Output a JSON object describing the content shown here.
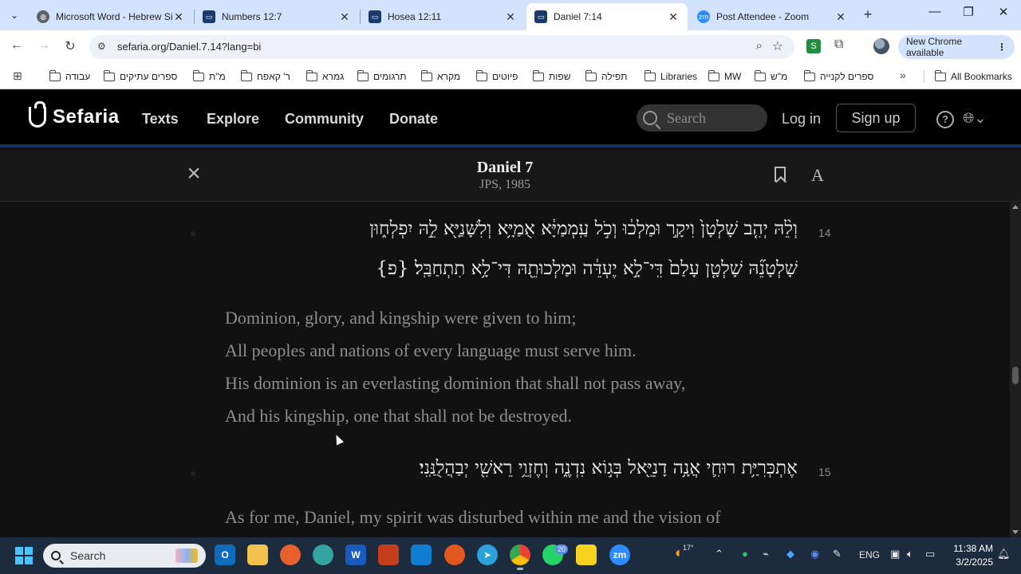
{
  "browser": {
    "tabs": [
      {
        "title": "Microsoft Word - Hebrew Si",
        "icon": "globe-icon",
        "active": false
      },
      {
        "title": "Numbers 12:7",
        "icon": "sefaria-icon",
        "active": false
      },
      {
        "title": "Hosea 12:11",
        "icon": "sefaria-icon",
        "active": false
      },
      {
        "title": "Daniel 7:14",
        "icon": "sefaria-icon",
        "active": true
      },
      {
        "title": "Post Attendee - Zoom",
        "icon": "zoom-icon",
        "active": false
      }
    ],
    "url": "sefaria.org/Daniel.7.14?lang=bi",
    "update_label": "New Chrome available",
    "bookmarks": [
      "עבודה",
      "ספרים עתיקים",
      "מ\"ת",
      "ר' קאפח",
      "גמרא",
      "תרגומים",
      "מקרא",
      "פיוטים",
      "שפות",
      "תפילה",
      "Libraries",
      "MW",
      "מ\"ש",
      "ספרים לקנייה"
    ],
    "all_bookmarks": "All Bookmarks"
  },
  "site": {
    "brand": "Sefaria",
    "nav": [
      "Texts",
      "Explore",
      "Community",
      "Donate"
    ],
    "search_placeholder": "Search",
    "login": "Log in",
    "signup": "Sign up"
  },
  "reader": {
    "title": "Daniel 7",
    "version": "JPS, 1985",
    "font_toggle": "A",
    "verses": [
      {
        "num": "14",
        "hebrew": [
          "וְלֵ֨הּ יְהִ֤ב שָׁלְטָן֙ וִיקָ֣ר וּמַלְכ֔וּ וְכֹ֣ל עַֽמְמַיָּ֔א אֻמַיָּ֥א וְלִשָּׁנַיָּ֖א לֵ֣הּ יִפְלְח֑וּן",
          "שָׁלְטָנֵ֞הּ שָׁלְטָ֤ן עָלַם֙ דִּֽי־לָ֣א יֶעְדֵּ֔ה וּמַלְכוּתֵ֖הּ דִּי־לָ֥א תִתְחַבַּֽל׃ {פ}"
        ],
        "english": [
          "Dominion, glory, and kingship were given to him;",
          "All peoples and nations of every language must serve him.",
          "His dominion is an everlasting dominion that shall not pass away,",
          "And his kingship, one that shall not be destroyed."
        ]
      },
      {
        "num": "15",
        "hebrew": [
          "אֶתְכְּרִיַּ֥ת רוּחִ֛י אֲנָ֥ה דָנִיֵּ֖אל בְּג֣וֹא נִדְנֶ֑ה וְחֶזְוֵ֥י רֵאשִׁ֖י יְבַהֲלֻנַּֽנִי׃"
        ],
        "english": [
          "As for me, Daniel, my spirit was disturbed within me and the vision of"
        ]
      }
    ]
  },
  "taskbar": {
    "search_label": "Search",
    "whatsapp_badge": "20",
    "weather": "17°",
    "language": "ENG",
    "time": "11:38 AM",
    "date": "3/2/2025"
  },
  "colors": {
    "tab_strip": "#d3e3fd",
    "sefaria_header": "#000000",
    "sefaria_accent": "#18345d",
    "reader_bg": "#111111",
    "taskbar": "#1c2b3d"
  }
}
